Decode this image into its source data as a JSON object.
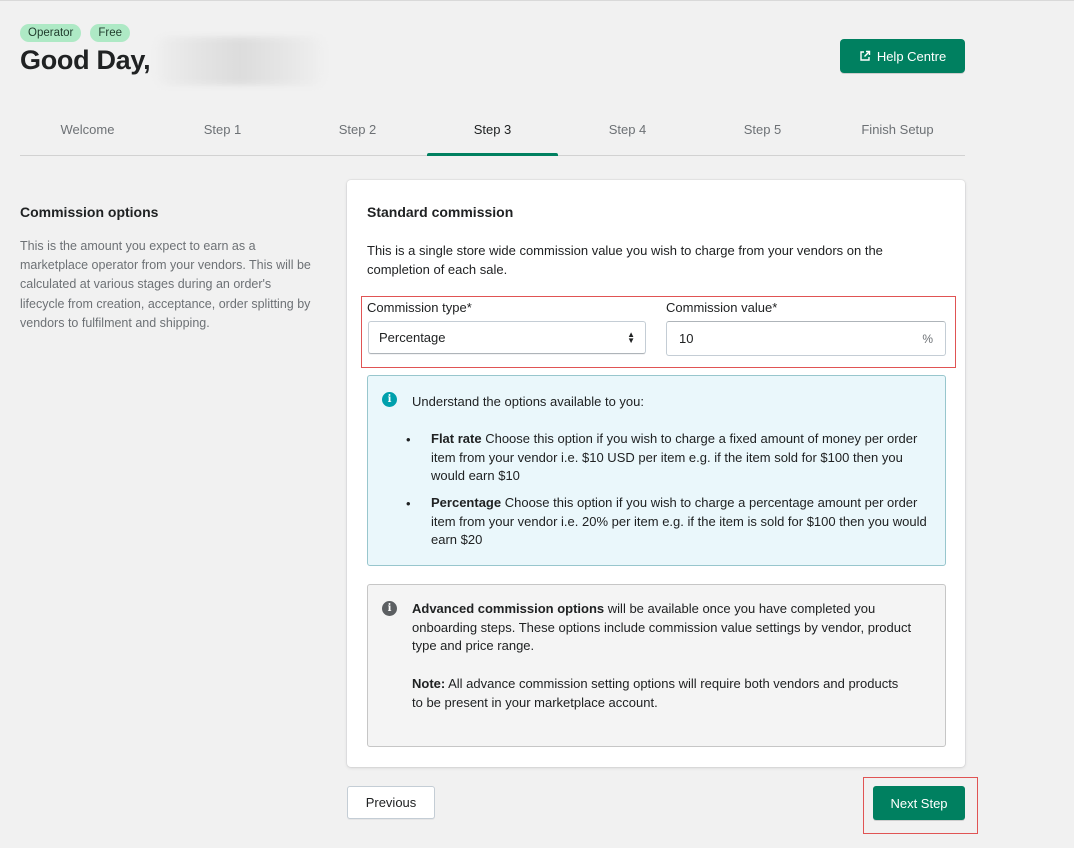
{
  "header": {
    "badges": [
      "Operator",
      "Free"
    ],
    "greeting": "Good Day,",
    "help_label": "Help Centre"
  },
  "tabs": [
    {
      "label": "Welcome"
    },
    {
      "label": "Step 1"
    },
    {
      "label": "Step 2"
    },
    {
      "label": "Step 3"
    },
    {
      "label": "Step 4"
    },
    {
      "label": "Step 5"
    },
    {
      "label": "Finish Setup"
    }
  ],
  "active_tab": "Step 3",
  "sidebar": {
    "title": "Commission options",
    "description": "This is the amount you expect to earn as a marketplace operator from your vendors. This will be calculated at various stages during an order's lifecycle from creation, acceptance, order splitting by vendors to fulfilment and shipping."
  },
  "card": {
    "title": "Standard commission",
    "description": "This is a single store wide commission value you wish to charge from your vendors on the completion of each sale.",
    "commission_type_label": "Commission type*",
    "commission_type_value": "Percentage",
    "commission_value_label": "Commission value*",
    "commission_value": "10",
    "commission_value_suffix": "%",
    "info": {
      "heading": "Understand the options available to you:",
      "flat_title": "Flat rate",
      "flat_text": "Choose this option if you wish to charge a fixed amount of money per order item from your vendor i.e. $10 USD per item e.g. if the item sold for $100 then you would earn $10",
      "pct_title": "Percentage",
      "pct_text": "Choose this option if you wish to charge a percentage amount per order item from your vendor i.e. 20% per item e.g. if the item is sold for $100 then you would earn $20"
    },
    "advanced": {
      "title": "Advanced commission options",
      "text": "will be available once you have completed you onboarding steps. These options include commission value settings by vendor, product type and price range.",
      "note_label": "Note:",
      "note_text": "All advance commission setting options will require both vendors and products to be present in your marketplace account."
    }
  },
  "footer": {
    "previous_label": "Previous",
    "next_label": "Next Step"
  },
  "colors": {
    "primary": "#008060",
    "badge": "#aee9c5",
    "info_bg": "#eaf7fb",
    "highlight": "#e05454"
  }
}
